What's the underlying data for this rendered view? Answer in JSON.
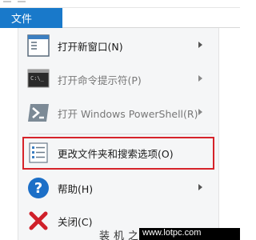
{
  "tab": {
    "label": "文件"
  },
  "menu": {
    "items": [
      {
        "label": "打开新窗口(N)",
        "icon": "new-window-icon",
        "disabled": false,
        "submenu": true
      },
      {
        "label": "打开命令提示符(P)",
        "icon": "command-prompt-icon",
        "disabled": true,
        "submenu": true
      },
      {
        "label": "打开 Windows PowerShell(R)",
        "icon": "powershell-icon",
        "disabled": true,
        "submenu": true
      },
      {
        "label": "更改文件夹和搜索选项(O)",
        "icon": "folder-options-icon",
        "disabled": false,
        "submenu": false
      },
      {
        "label": "帮助(H)",
        "icon": "help-icon",
        "disabled": false,
        "submenu": true
      },
      {
        "label": "关闭(C)",
        "icon": "close-icon",
        "disabled": false,
        "submenu": false
      }
    ]
  },
  "watermark": {
    "cn": "装机之家",
    "en": "www.lotpc.com"
  },
  "colors": {
    "tab_bg": "#1979ca",
    "highlight": "#d6232a",
    "help_blue": "#1c6fc7",
    "close_red": "#d0202a"
  }
}
